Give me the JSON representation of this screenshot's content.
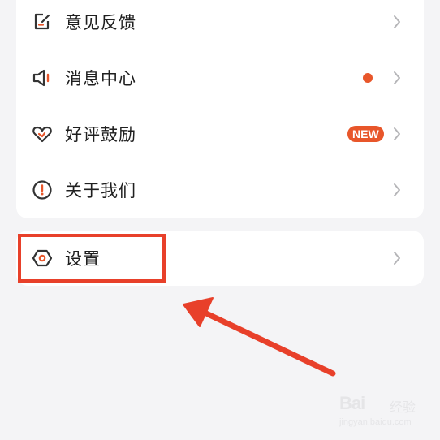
{
  "menu": {
    "items": [
      {
        "label": "意见反馈",
        "icon": "edit-icon"
      },
      {
        "label": "消息中心",
        "icon": "speaker-icon",
        "indicator": "dot"
      },
      {
        "label": "好评鼓励",
        "icon": "heart-icon",
        "badge": "NEW"
      },
      {
        "label": "关于我们",
        "icon": "info-icon"
      }
    ]
  },
  "settings": {
    "label": "设置",
    "icon": "gear-hexagon-icon"
  },
  "colors": {
    "accent": "#e8562a",
    "icon": "#333333",
    "chevron": "#b5b5b8",
    "annotation": "#e8402a",
    "background": "#f4f4f6",
    "card": "#ffffff"
  },
  "watermark": {
    "brand": "Bai",
    "brand_suffix": "经验",
    "url": "jingyan.baidu.com"
  }
}
